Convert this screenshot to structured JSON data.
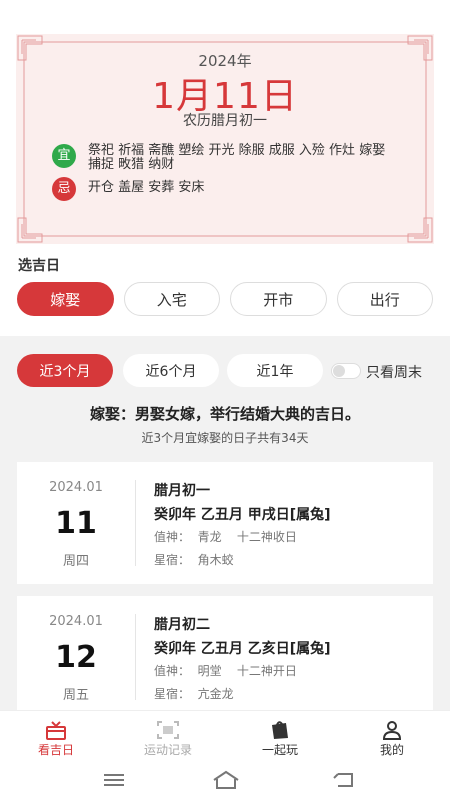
{
  "calendar": {
    "year": "2024年",
    "date": "1月11日",
    "lunar": "农历腊月初一",
    "yi_badge": "宜",
    "yi_text": "祭祀 祈福 斋醮 塑绘 开光 除服 成服 入殓 作灶 嫁娶 捕捉 畋猎 纳财",
    "ji_badge": "忌",
    "ji_text": "开仓 盖屋 安葬 安床"
  },
  "section_title": "选吉日",
  "categories": [
    {
      "label": "嫁娶",
      "active": true
    },
    {
      "label": "入宅",
      "active": false
    },
    {
      "label": "开市",
      "active": false
    },
    {
      "label": "出行",
      "active": false
    }
  ],
  "ranges": [
    {
      "label": "近3个月",
      "active": true
    },
    {
      "label": "近6个月",
      "active": false
    },
    {
      "label": "近1年",
      "active": false
    }
  ],
  "weekend_toggle": {
    "label": "只看周末",
    "on": false
  },
  "headline": "嫁娶：男娶女嫁，举行结婚大典的吉日。",
  "subline": "近3个月宜嫁娶的日子共有34天",
  "days": [
    {
      "ym": "2024.01",
      "day": "11",
      "weekday": "周四",
      "lunar": "腊月初一",
      "ganzhi": "癸卯年 乙丑月 甲戌日[属兔]",
      "zhishen": "值神：  青龙    十二神收日",
      "xingxiu": "星宿：  角木蛟"
    },
    {
      "ym": "2024.01",
      "day": "12",
      "weekday": "周五",
      "lunar": "腊月初二",
      "ganzhi": "癸卯年 乙丑月 乙亥日[属兔]",
      "zhishen": "值神：  明堂    十二神开日",
      "xingxiu": "星宿：  亢金龙"
    }
  ],
  "tabs": [
    {
      "label": "看吉日",
      "icon": "calendar-gift-icon",
      "state": "active"
    },
    {
      "label": "运动记录",
      "icon": "scan-frame-icon",
      "state": "muted"
    },
    {
      "label": "一起玩",
      "icon": "bag-icon",
      "state": "normal"
    },
    {
      "label": "我的",
      "icon": "user-icon",
      "state": "normal"
    }
  ],
  "colors": {
    "accent": "#d6383a",
    "yi_green": "#2fa94a",
    "card_bg": "#fbeeed"
  }
}
